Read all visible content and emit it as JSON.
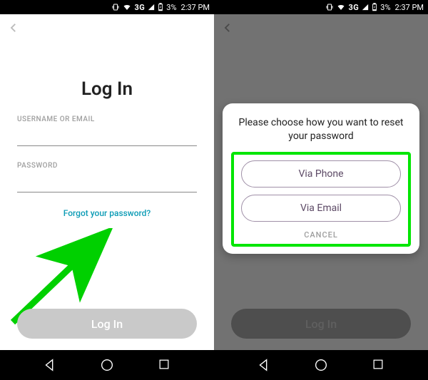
{
  "status": {
    "network": "3G",
    "battery": "3%",
    "time": "2:37 PM"
  },
  "login": {
    "title": "Log In",
    "username_label": "USERNAME OR EMAIL",
    "password_label": "PASSWORD",
    "forgot": "Forgot your password?",
    "button": "Log In"
  },
  "modal": {
    "title": "Please choose how you want to reset your password",
    "via_phone": "Via Phone",
    "via_email": "Via Email",
    "cancel": "CANCEL"
  }
}
